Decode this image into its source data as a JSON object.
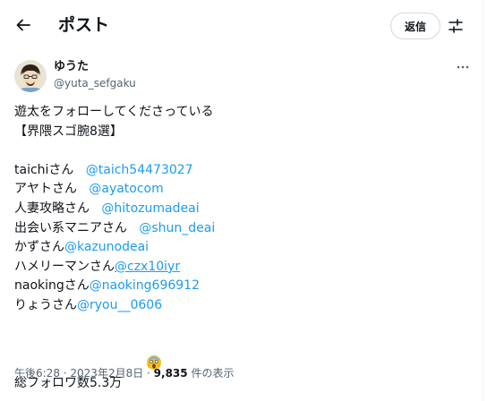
{
  "header": {
    "title": "ポスト",
    "reply_label": "返信"
  },
  "author": {
    "name": "ゆうた",
    "handle": "@yuta_sefgaku"
  },
  "post": {
    "intro1": "遊太をフォローしてくださっている",
    "intro2": "【界隈スゴ腕8選】",
    "accounts": [
      {
        "name": "taichiさん",
        "mention": "@taich54473027"
      },
      {
        "name": "アヤトさん",
        "mention": "@ayatocom"
      },
      {
        "name": "人妻攻略さん",
        "mention": "@hitozumadeai"
      },
      {
        "name": "出会い系マニアさん",
        "mention": "@shun_deai"
      },
      {
        "name": "かずさん",
        "mention": "@kazunodeai"
      },
      {
        "name": "ハメリーマンさん",
        "mention": "@czx10iyr"
      },
      {
        "name": "naokingさん",
        "mention": "@naoking696912"
      },
      {
        "name": "りょうさん",
        "mention": "@ryou__0606"
      }
    ],
    "summary": "総フォロワ数5.3万"
  },
  "meta": {
    "time": "午後6:28",
    "date": "2023年2月8日",
    "views": "9,835",
    "views_label": "件の表示"
  },
  "colors": {
    "accent": "#1d9bf0",
    "text": "#0f1419",
    "secondary": "#536471"
  },
  "icons": [
    "back-arrow-icon",
    "tune-icon",
    "more-icon",
    "scream-emoji-icon"
  ]
}
